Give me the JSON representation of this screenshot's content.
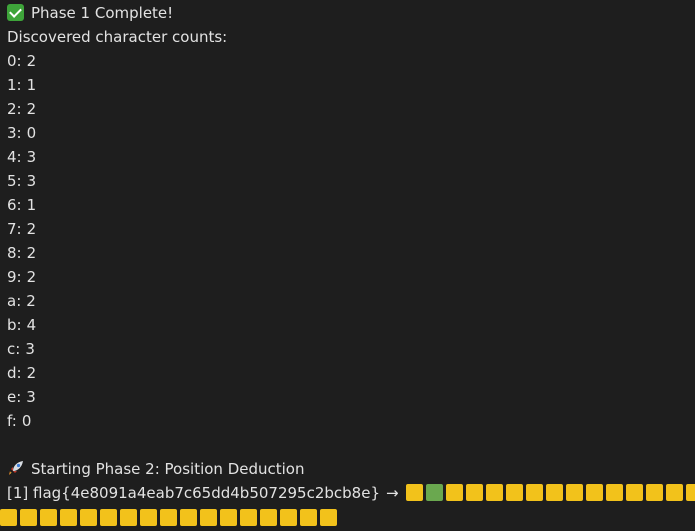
{
  "phase1": {
    "header_icon": "check-mark-icon",
    "header": "Phase 1 Complete!",
    "subheader": "Discovered character counts:"
  },
  "counts": [
    {
      "key": "0",
      "value": "2"
    },
    {
      "key": "1",
      "value": "1"
    },
    {
      "key": "2",
      "value": "2"
    },
    {
      "key": "3",
      "value": "0"
    },
    {
      "key": "4",
      "value": "3"
    },
    {
      "key": "5",
      "value": "3"
    },
    {
      "key": "6",
      "value": "1"
    },
    {
      "key": "7",
      "value": "2"
    },
    {
      "key": "8",
      "value": "2"
    },
    {
      "key": "9",
      "value": "2"
    },
    {
      "key": "a",
      "value": "2"
    },
    {
      "key": "b",
      "value": "4"
    },
    {
      "key": "c",
      "value": "3"
    },
    {
      "key": "d",
      "value": "2"
    },
    {
      "key": "e",
      "value": "3"
    },
    {
      "key": "f",
      "value": "0"
    }
  ],
  "phase2": {
    "header_icon": "rocket-icon",
    "header": "Starting Phase 2: Position Deduction"
  },
  "attempt": {
    "text": "[1] flag{4e8091a4eab7c65dd4b507295c2bcb8e}",
    "arrow": "→",
    "colors": {
      "yellow": "#f2c21b",
      "green": "#6aa84f"
    },
    "row1": [
      "yellow",
      "green",
      "yellow",
      "yellow",
      "yellow",
      "yellow",
      "yellow",
      "yellow",
      "yellow",
      "yellow",
      "yellow",
      "yellow",
      "yellow",
      "yellow",
      "yellow"
    ],
    "row2": [
      "yellow",
      "yellow",
      "yellow",
      "yellow",
      "yellow",
      "yellow",
      "yellow",
      "yellow",
      "yellow",
      "yellow",
      "yellow",
      "yellow",
      "yellow",
      "yellow",
      "yellow",
      "yellow",
      "yellow"
    ]
  }
}
